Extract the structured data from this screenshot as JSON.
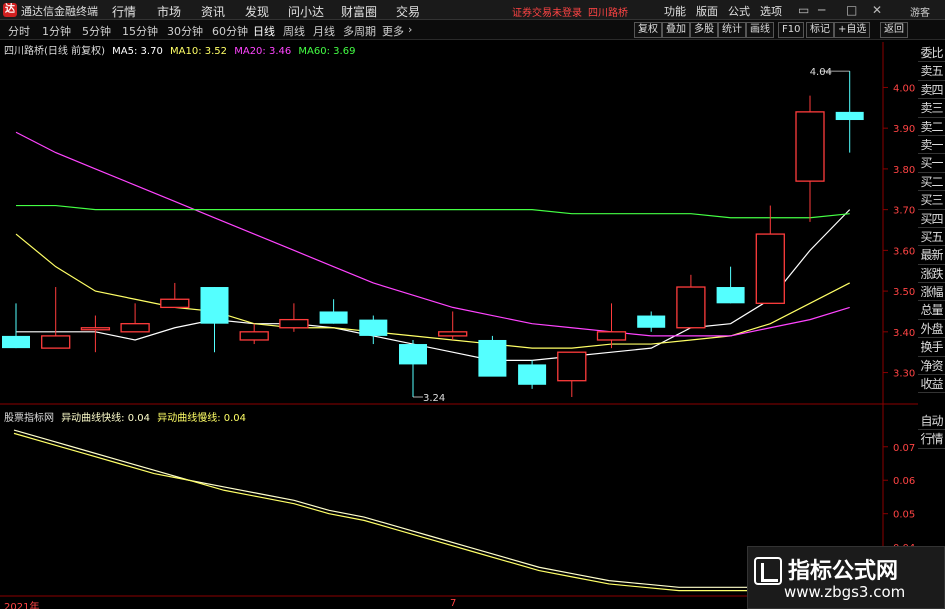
{
  "titlebar": {
    "app_title": "通达信金融终端",
    "menus": [
      "行情",
      "市场",
      "资讯",
      "发现",
      "问小达",
      "财富圈",
      "交易"
    ],
    "login_status": "证券交易未登录",
    "stock_name": "四川路桥",
    "right_menus": [
      "功能",
      "版面",
      "公式",
      "选项"
    ],
    "guest": "游客"
  },
  "toolbar": {
    "periods": [
      "分时",
      "1分钟",
      "5分钟",
      "15分钟",
      "30分钟",
      "60分钟",
      "日线",
      "周线",
      "月线",
      "多周期",
      "更多"
    ],
    "active_period": "日线",
    "right_buttons": [
      "复权",
      "叠加",
      "多股",
      "统计",
      "画线",
      "F10",
      "标记",
      "+自选",
      "返回"
    ]
  },
  "info": {
    "title": "四川路桥(日线 前复权)",
    "ma": [
      {
        "label": "MA5: 3.70",
        "color": "#ffffff"
      },
      {
        "label": "MA10: 3.52",
        "color": "#ffff66"
      },
      {
        "label": "MA20: 3.46",
        "color": "#ff44ff"
      },
      {
        "label": "MA60: 3.69",
        "color": "#44ff44"
      }
    ]
  },
  "right_list": [
    "委比",
    "卖五",
    "卖四",
    "卖三",
    "卖二",
    "卖一",
    "买一",
    "买二",
    "买三",
    "买四",
    "买五",
    "最新",
    "涨跌",
    "涨幅",
    "总量",
    "外盘",
    "换手",
    "净资",
    "收益"
  ],
  "right_list2": [
    "自动",
    "行情"
  ],
  "price_axis": [
    "4.00",
    "3.90",
    "3.80",
    "3.70",
    "3.60",
    "3.50",
    "3.40",
    "3.30"
  ],
  "indicator_axis": [
    "0.07",
    "0.06",
    "0.05",
    "0.04",
    "0.03"
  ],
  "annotations": {
    "high": "4.04",
    "low": "3.24"
  },
  "sub_info": {
    "name": "股票指标网",
    "fast": "异动曲线快线: 0.04",
    "slow": "异动曲线慢线: 0.04"
  },
  "colors": {
    "up": "#ff3c3c",
    "down": "#54ffff"
  },
  "x_labels": {
    "year": "2021年",
    "month": "7"
  },
  "watermark": {
    "title": "指标公式网",
    "url": "www.zbgs3.com"
  },
  "chart_data": {
    "type": "candlestick",
    "candles": [
      {
        "o": 3.39,
        "h": 3.47,
        "l": 3.36,
        "c": 3.36
      },
      {
        "o": 3.36,
        "h": 3.51,
        "l": 3.36,
        "c": 3.39
      },
      {
        "o": 3.41,
        "h": 3.44,
        "l": 3.35,
        "c": 3.41
      },
      {
        "o": 3.4,
        "h": 3.47,
        "l": 3.4,
        "c": 3.42
      },
      {
        "o": 3.46,
        "h": 3.52,
        "l": 3.46,
        "c": 3.48
      },
      {
        "o": 3.51,
        "h": 3.51,
        "l": 3.35,
        "c": 3.42
      },
      {
        "o": 3.38,
        "h": 3.42,
        "l": 3.37,
        "c": 3.4
      },
      {
        "o": 3.41,
        "h": 3.47,
        "l": 3.4,
        "c": 3.43
      },
      {
        "o": 3.45,
        "h": 3.48,
        "l": 3.42,
        "c": 3.42
      },
      {
        "o": 3.43,
        "h": 3.44,
        "l": 3.37,
        "c": 3.39
      },
      {
        "o": 3.37,
        "h": 3.38,
        "l": 3.24,
        "c": 3.32
      },
      {
        "o": 3.39,
        "h": 3.45,
        "l": 3.38,
        "c": 3.4
      },
      {
        "o": 3.38,
        "h": 3.39,
        "l": 3.31,
        "c": 3.29
      },
      {
        "o": 3.32,
        "h": 3.33,
        "l": 3.26,
        "c": 3.27
      },
      {
        "o": 3.28,
        "h": 3.35,
        "l": 3.24,
        "c": 3.35
      },
      {
        "o": 3.38,
        "h": 3.47,
        "l": 3.36,
        "c": 3.4
      },
      {
        "o": 3.44,
        "h": 3.45,
        "l": 3.4,
        "c": 3.41
      },
      {
        "o": 3.41,
        "h": 3.54,
        "l": 3.41,
        "c": 3.51
      },
      {
        "o": 3.51,
        "h": 3.56,
        "l": 3.47,
        "c": 3.47
      },
      {
        "o": 3.47,
        "h": 3.71,
        "l": 3.47,
        "c": 3.64
      },
      {
        "o": 3.77,
        "h": 3.98,
        "l": 3.67,
        "c": 3.94
      },
      {
        "o": 3.94,
        "h": 4.04,
        "l": 3.84,
        "c": 3.92
      }
    ],
    "ma_series": [
      {
        "name": "MA5",
        "color": "#ffffff",
        "values": [
          3.4,
          3.4,
          3.4,
          3.38,
          3.41,
          3.43,
          3.42,
          3.42,
          3.41,
          3.39,
          3.37,
          3.35,
          3.33,
          3.33,
          3.34,
          3.35,
          3.36,
          3.41,
          3.42,
          3.48,
          3.6,
          3.7
        ]
      },
      {
        "name": "MA10",
        "color": "#ffff66",
        "values": [
          3.64,
          3.56,
          3.5,
          3.48,
          3.46,
          3.45,
          3.42,
          3.41,
          3.41,
          3.4,
          3.39,
          3.38,
          3.37,
          3.36,
          3.36,
          3.37,
          3.37,
          3.38,
          3.39,
          3.42,
          3.47,
          3.52
        ]
      },
      {
        "name": "MA20",
        "color": "#ff44ff",
        "values": [
          3.89,
          3.84,
          3.8,
          3.76,
          3.72,
          3.68,
          3.64,
          3.6,
          3.56,
          3.52,
          3.49,
          3.46,
          3.44,
          3.42,
          3.41,
          3.4,
          3.39,
          3.39,
          3.39,
          3.41,
          3.43,
          3.46
        ]
      },
      {
        "name": "MA60",
        "color": "#44ff44",
        "values": [
          3.71,
          3.71,
          3.7,
          3.7,
          3.7,
          3.7,
          3.7,
          3.7,
          3.7,
          3.7,
          3.7,
          3.7,
          3.7,
          3.7,
          3.69,
          3.69,
          3.69,
          3.69,
          3.68,
          3.68,
          3.68,
          3.69
        ]
      }
    ],
    "indicator": [
      {
        "name": "异动曲线快线",
        "color": "#ffffcc",
        "values": [
          0.075,
          0.072,
          0.069,
          0.066,
          0.063,
          0.06,
          0.058,
          0.056,
          0.054,
          0.051,
          0.049,
          0.046,
          0.043,
          0.04,
          0.037,
          0.034,
          0.032,
          0.03,
          0.029,
          0.028,
          0.028,
          0.028
        ]
      },
      {
        "name": "异动曲线慢线",
        "color": "#ffff66",
        "values": [
          0.074,
          0.071,
          0.068,
          0.065,
          0.062,
          0.06,
          0.057,
          0.055,
          0.053,
          0.05,
          0.048,
          0.045,
          0.042,
          0.039,
          0.036,
          0.033,
          0.031,
          0.029,
          0.028,
          0.027,
          0.027,
          0.027
        ]
      }
    ],
    "ylim_price": [
      3.24,
      4.06
    ],
    "ylim_indicator": [
      0.026,
      0.078
    ]
  }
}
